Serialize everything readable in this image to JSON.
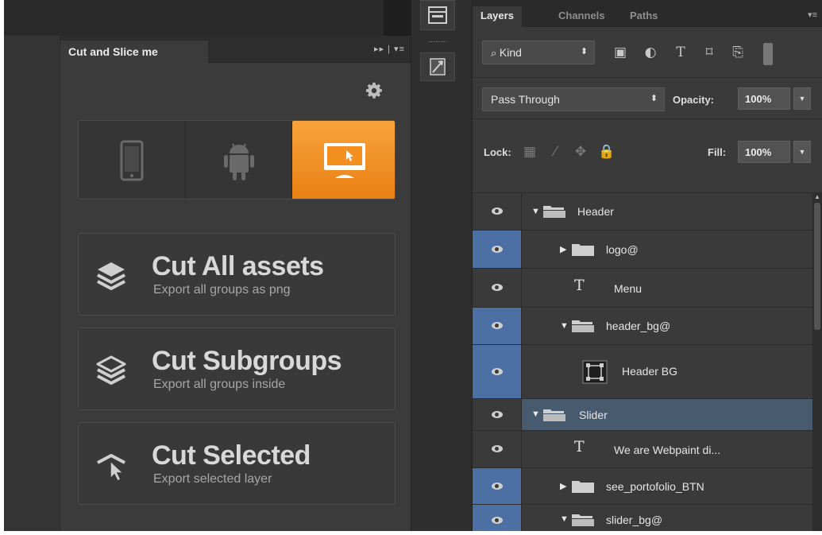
{
  "plugin_panel": {
    "tab_title": "Cut and Slice me",
    "controls": "▸▸ | ▾≡",
    "devices": [
      "mobile",
      "android",
      "desktop"
    ],
    "selected_device": "desktop",
    "actions": [
      {
        "title": "Cut All assets",
        "subtitle": "Export all groups as png",
        "icon": "layers-stack-icon"
      },
      {
        "title": "Cut Subgroups",
        "subtitle": "Export all groups inside",
        "icon": "layers-outline-icon"
      },
      {
        "title": "Cut Selected",
        "subtitle": "Export selected layer",
        "icon": "cursor-layers-icon"
      }
    ]
  },
  "layers_panel": {
    "tabs": [
      "Layers",
      "Channels",
      "Paths"
    ],
    "active_tab": "Layers",
    "kind_filter": "Kind",
    "blend_mode": "Pass Through",
    "opacity_label": "Opacity:",
    "opacity": "100%",
    "lock_label": "Lock:",
    "fill_label": "Fill:",
    "fill": "100%",
    "layers": [
      {
        "name": "Header",
        "type": "group",
        "expanded": true,
        "indent": 0
      },
      {
        "name": "logo@",
        "type": "group",
        "expanded": false,
        "indent": 1
      },
      {
        "name": "Menu",
        "type": "text",
        "indent": 1
      },
      {
        "name": "header_bg@",
        "type": "group",
        "expanded": true,
        "indent": 1
      },
      {
        "name": "Header BG",
        "type": "shape",
        "indent": 2
      },
      {
        "name": "Slider",
        "type": "group",
        "expanded": true,
        "indent": 0
      },
      {
        "name": "We are Webpaint di...",
        "type": "text",
        "indent": 1
      },
      {
        "name": "see_portofolio_BTN",
        "type": "group",
        "expanded": false,
        "indent": 1
      },
      {
        "name": "slider_bg@",
        "type": "group",
        "expanded": true,
        "indent": 1
      }
    ]
  },
  "colors": {
    "accent": "#f39425",
    "selection": "#4c70a4",
    "panel": "#3b3b3b"
  }
}
